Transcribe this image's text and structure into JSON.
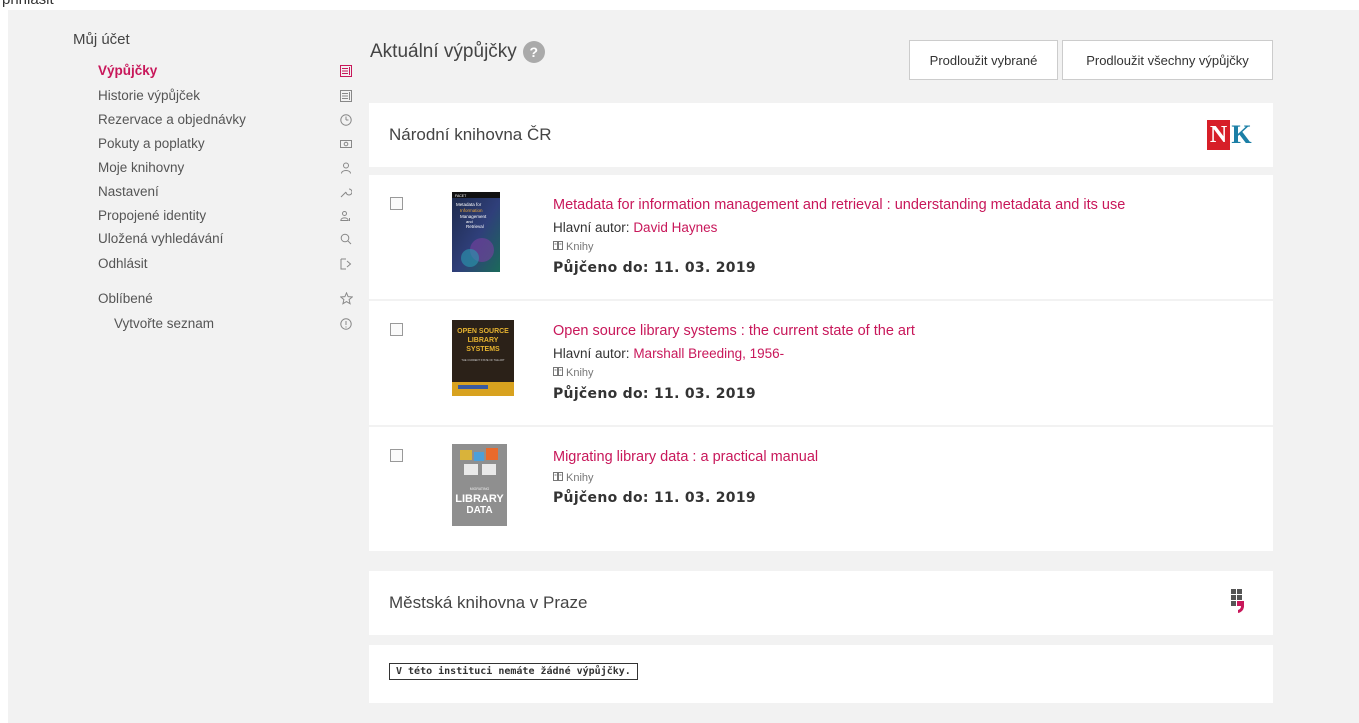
{
  "top_text": "přihlásit",
  "sidebar": {
    "title": "Můj účet",
    "items": [
      {
        "label": "Výpůjčky",
        "icon": "list-icon",
        "active": true
      },
      {
        "label": "Historie výpůjček",
        "icon": "list-icon"
      },
      {
        "label": "Rezervace a objednávky",
        "icon": "clock-icon"
      },
      {
        "label": "Pokuty a poplatky",
        "icon": "money-icon"
      },
      {
        "label": "Moje knihovny",
        "icon": "user-icon"
      },
      {
        "label": "Nastavení",
        "icon": "wrench-icon"
      },
      {
        "label": "Propojené identity",
        "icon": "users-icon"
      },
      {
        "label": "Uložená vyhledávání",
        "icon": "search-icon"
      },
      {
        "label": "Odhlásit",
        "icon": "logout-icon"
      }
    ],
    "favorites": {
      "label": "Oblíbené",
      "icon": "star-icon"
    },
    "create_list": {
      "label": "Vytvořte seznam",
      "icon": "info-icon"
    }
  },
  "main": {
    "title": "Aktuální výpůjčky",
    "help": "?",
    "renew_selected": "Prodloužit vybrané",
    "renew_all": "Prodloužit všechny výpůjčky"
  },
  "libraries": [
    {
      "name": "Národní knihovna ČR",
      "logo": {
        "n": "N",
        "k": "K"
      },
      "items": [
        {
          "title": "Metadata for information management and retrieval : understanding metadata and its use",
          "author_label": "Hlavní autor:",
          "author": "David Haynes",
          "format": "Knihy",
          "due": "Půjčeno do: 11. 03. 2019"
        },
        {
          "title": "Open source library systems : the current state of the art",
          "author_label": "Hlavní autor:",
          "author": "Marshall Breeding, 1956-",
          "format": "Knihy",
          "due": "Půjčeno do: 11. 03. 2019"
        },
        {
          "title": "Migrating library data : a practical manual",
          "format": "Knihy",
          "due": "Půjčeno do: 11. 03. 2019"
        }
      ]
    },
    {
      "name": "Městská knihovna v Praze",
      "no_loans": "V této instituci nemáte žádné výpůjčky."
    }
  ],
  "covers": {
    "book1": {
      "brand": "FACET",
      "lines": [
        "Metadata for",
        "Information",
        "Management",
        "and",
        "Retrieval"
      ]
    },
    "book2": {
      "lines": [
        "OPEN SOURCE",
        "LIBRARY",
        "SYSTEMS",
        "THE CURRENT STATE OF THE ART"
      ]
    },
    "book3": {
      "lines": [
        "MIGRATING",
        "LIBRARY",
        "DATA"
      ]
    }
  },
  "colors": {
    "accent": "#c8175a",
    "background": "#f2f2f2"
  }
}
